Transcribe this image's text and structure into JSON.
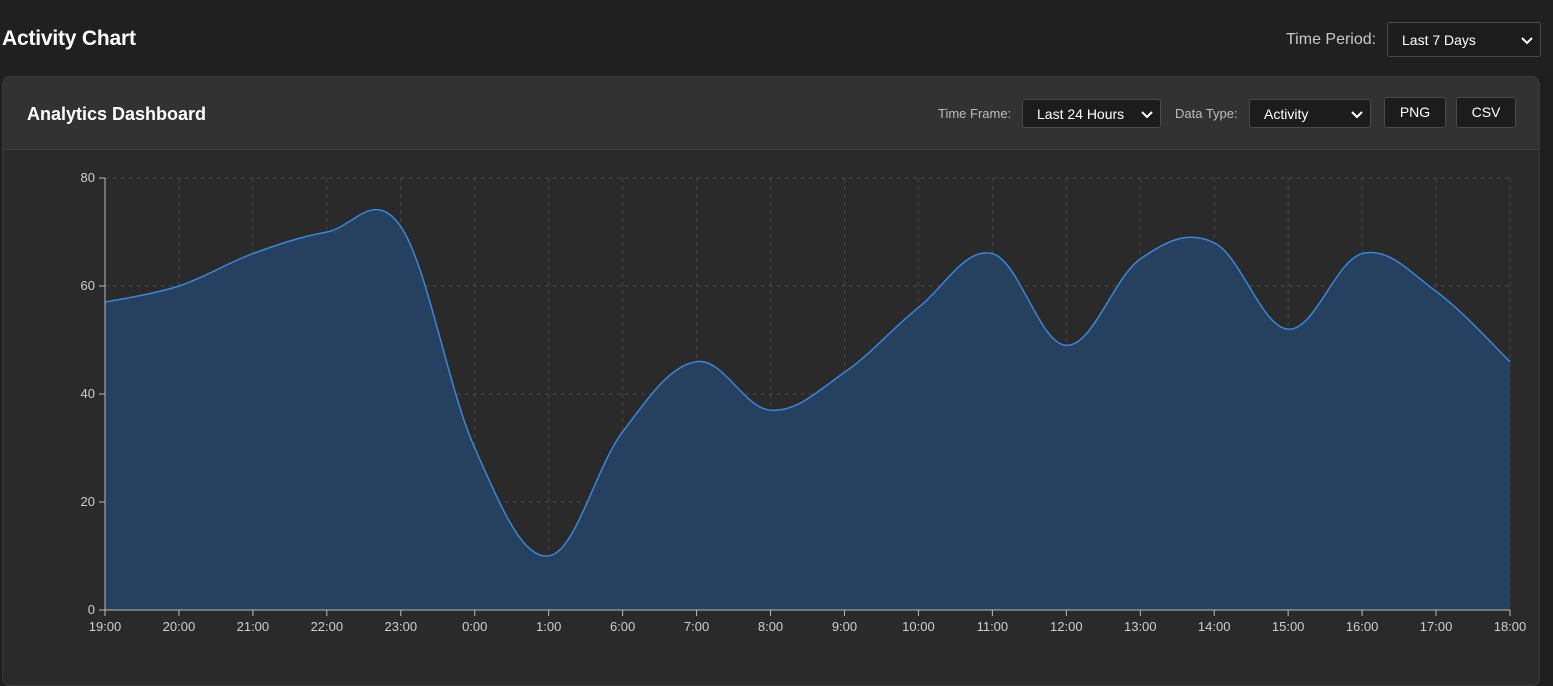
{
  "header": {
    "title": "Activity Chart",
    "time_period_label": "Time Period:",
    "time_period_value": "Last 7 Days"
  },
  "panel": {
    "title": "Analytics Dashboard",
    "time_frame_label": "Time Frame:",
    "time_frame_value": "Last 24 Hours",
    "data_type_label": "Data Type:",
    "data_type_value": "Activity",
    "png_label": "PNG",
    "csv_label": "CSV"
  },
  "colors": {
    "line": "#3a86d8",
    "area": "#25415f",
    "grid": "#4a4a4a",
    "axis": "#bcbcbc"
  },
  "chart_data": {
    "type": "area",
    "categories": [
      "19:00",
      "20:00",
      "21:00",
      "22:00",
      "23:00",
      "0:00",
      "1:00",
      "6:00",
      "7:00",
      "8:00",
      "9:00",
      "10:00",
      "11:00",
      "12:00",
      "13:00",
      "14:00",
      "15:00",
      "16:00",
      "17:00",
      "18:00"
    ],
    "values": [
      57,
      60,
      66,
      70,
      71,
      30,
      10,
      33,
      46,
      37,
      44,
      56,
      66,
      49,
      65,
      68,
      52,
      66,
      59,
      46
    ],
    "ylim": [
      0,
      80
    ],
    "yticks": [
      0,
      20,
      40,
      60,
      80
    ],
    "grid": true
  }
}
